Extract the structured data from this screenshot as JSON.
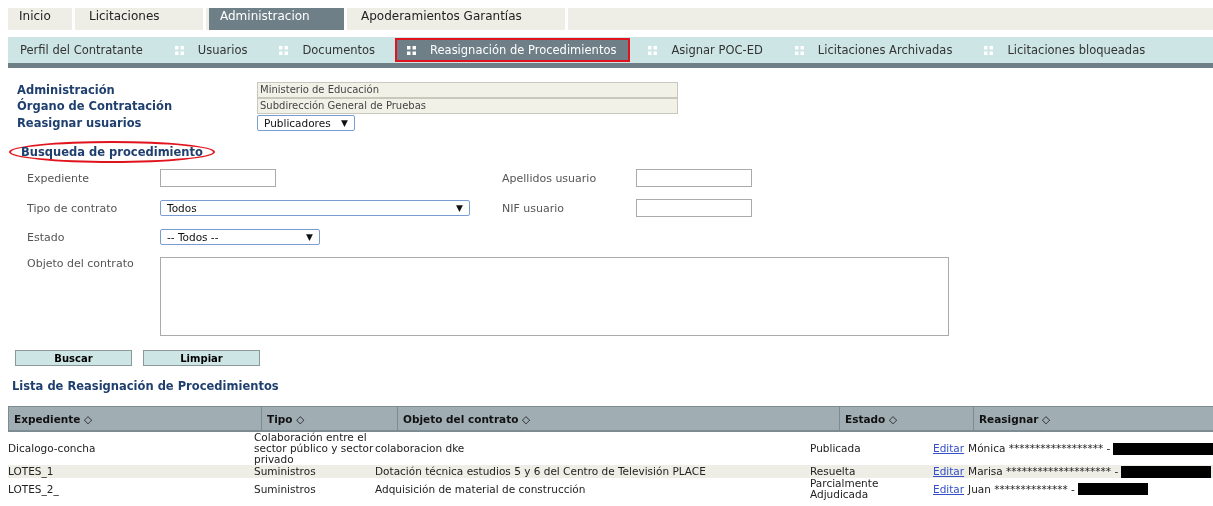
{
  "main_tabs": [
    {
      "label": "Inicio",
      "selected": false
    },
    {
      "label": "Licitaciones",
      "selected": false
    },
    {
      "label": "Administracion",
      "selected": true
    },
    {
      "label": "Apoderamientos Garantías",
      "selected": false
    }
  ],
  "sub_tabs": [
    {
      "label": "Perfil del Contratante",
      "selected": false,
      "icon": false
    },
    {
      "label": "Usuarios",
      "selected": false,
      "icon": true
    },
    {
      "label": "Documentos",
      "selected": false,
      "icon": true
    },
    {
      "label": "Reasignación de Procedimientos",
      "selected": true,
      "icon": true
    },
    {
      "label": "Asignar POC-ED",
      "selected": false,
      "icon": true
    },
    {
      "label": "Licitaciones Archivadas",
      "selected": false,
      "icon": true
    },
    {
      "label": "Licitaciones bloqueadas",
      "selected": false,
      "icon": true
    }
  ],
  "info": [
    {
      "label": "Administración",
      "kind": "readonly",
      "value": "Ministerio de Educación"
    },
    {
      "label": "Órgano de Contratación",
      "kind": "readonly",
      "value": "Subdirección General de Pruebas"
    },
    {
      "label": "Reasignar usuarios",
      "kind": "select",
      "value": "Publicadores",
      "arrow": "▼"
    }
  ],
  "search": {
    "title": "Busqueda de procedimiento",
    "circled": true,
    "fields": [
      {
        "label": "Expediente",
        "kind": "input"
      },
      {
        "label": "Apellidos usuario",
        "kind": "input"
      },
      {
        "label": "Tipo de contrato",
        "kind": "select",
        "value": "Todos",
        "arrow": "▼"
      },
      {
        "label": "NIF usuario",
        "kind": "input"
      },
      {
        "label": "Estado",
        "kind": "select",
        "value": "-- Todos --",
        "arrow": "▼"
      },
      {
        "label": "Objeto del contrato",
        "kind": "textarea"
      }
    ],
    "buttons": [
      "Buscar",
      "Limpiar"
    ]
  },
  "list": {
    "title": "Lista de Reasignación de Procedimientos",
    "columns": [
      {
        "label": "Expediente",
        "sort": "◇"
      },
      {
        "label": "Tipo",
        "sort": "◇"
      },
      {
        "label": "Objeto del contrato",
        "sort": "◇"
      },
      {
        "label": "Estado",
        "sort": "◇"
      },
      {
        "label": "Reasignar",
        "sort": "◇"
      }
    ],
    "rows": [
      {
        "expediente": "Dicalogo-concha",
        "tipo": "Colaboración entre el sector público y sector privado",
        "objeto": "colaboracion dke",
        "estado": "Publicada",
        "link": "Editar",
        "usuario": "Mónica ****************** -"
      },
      {
        "expediente": "LOTES_1",
        "tipo": "Suministros",
        "objeto": "Dotación técnica estudios 5 y 6 del Centro de Televisión PLACE",
        "estado": "Resuelta",
        "link": "Editar",
        "usuario": "Marisa ******************** -"
      },
      {
        "expediente": "LOTES_2_",
        "tipo": "Suministros",
        "objeto": "Adquisición de material de construcción",
        "estado": "Parcialmente Adjudicada",
        "link": "Editar",
        "usuario": "Juan ************** -"
      }
    ]
  }
}
